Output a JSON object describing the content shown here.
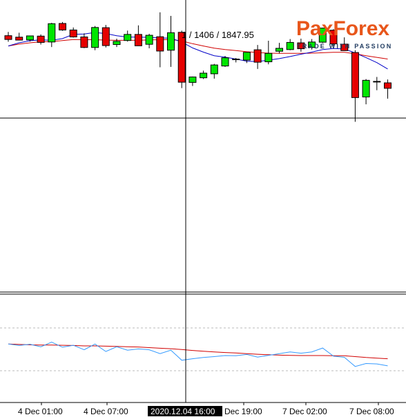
{
  "brand": {
    "name_part1": "Pa",
    "name_mark": "x",
    "name_part2": "Forex",
    "tagline": "TRADE WITH PASSION",
    "orange": "#e8561b",
    "navy": "#1f3a5f"
  },
  "crosshair_readout": "1 / 1406 / 1847.95",
  "colors": {
    "bull": "#00e600",
    "bear": "#e60000",
    "ma_fast": "#0000c8",
    "ma_slow": "#d00000",
    "osc_fast": "#3399ff",
    "osc_slow": "#d00000",
    "grid": "#bbbbbb",
    "crosshair": "#000000"
  },
  "chart_data": [
    {
      "type": "candlestick",
      "timeframe": "1 hour",
      "x_tick_labels": [
        "4 Dec 01:00",
        "4 Dec 07:00",
        "2020.12.04 16:00",
        "Dec 19:00",
        "7 Dec 02:00",
        "7 Dec 08:00"
      ],
      "highlighted_x_label": "2020.12.04 16:00",
      "candles": [
        {
          "o": 1847.4,
          "h": 1849.2,
          "l": 1844.5,
          "c": 1845.6
        },
        {
          "o": 1846.7,
          "h": 1848.8,
          "l": 1845.2,
          "c": 1845.3
        },
        {
          "o": 1845.4,
          "h": 1846.5,
          "l": 1844.6,
          "c": 1847.3
        },
        {
          "o": 1847.2,
          "h": 1848.0,
          "l": 1843.2,
          "c": 1844.2
        },
        {
          "o": 1844.4,
          "h": 1853.5,
          "l": 1842.0,
          "c": 1853.1
        },
        {
          "o": 1853.2,
          "h": 1853.9,
          "l": 1849.7,
          "c": 1850.1
        },
        {
          "o": 1850.1,
          "h": 1851.3,
          "l": 1846.5,
          "c": 1846.8
        },
        {
          "o": 1846.8,
          "h": 1848.5,
          "l": 1841.5,
          "c": 1841.8
        },
        {
          "o": 1841.8,
          "h": 1852.0,
          "l": 1840.5,
          "c": 1851.3
        },
        {
          "o": 1851.2,
          "h": 1852.5,
          "l": 1841.8,
          "c": 1842.7
        },
        {
          "o": 1843.2,
          "h": 1846.0,
          "l": 1842.0,
          "c": 1844.7
        },
        {
          "o": 1845.1,
          "h": 1849.8,
          "l": 1844.6,
          "c": 1848.0
        },
        {
          "o": 1848.0,
          "h": 1852.3,
          "l": 1843.4,
          "c": 1842.6
        },
        {
          "o": 1843.3,
          "h": 1848.3,
          "l": 1841.4,
          "c": 1847.6
        },
        {
          "o": 1846.9,
          "h": 1858.5,
          "l": 1832.4,
          "c": 1840.1
        },
        {
          "o": 1840.5,
          "h": 1856.8,
          "l": 1832.6,
          "c": 1848.8
        },
        {
          "o": 1849.0,
          "h": 1849.8,
          "l": 1822.5,
          "c": 1825.3
        },
        {
          "o": 1825.2,
          "h": 1828.0,
          "l": 1823.5,
          "c": 1827.8
        },
        {
          "o": 1827.4,
          "h": 1830.8,
          "l": 1826.8,
          "c": 1829.6
        },
        {
          "o": 1829.3,
          "h": 1834.0,
          "l": 1827.0,
          "c": 1833.5
        },
        {
          "o": 1833.0,
          "h": 1837.8,
          "l": 1832.6,
          "c": 1836.9
        },
        {
          "o": 1836.3,
          "h": 1836.8,
          "l": 1834.7,
          "c": 1836.2
        },
        {
          "o": 1835.8,
          "h": 1838.8,
          "l": 1834.4,
          "c": 1839.5
        },
        {
          "o": 1840.7,
          "h": 1843.0,
          "l": 1831.6,
          "c": 1834.8
        },
        {
          "o": 1835.0,
          "h": 1845.0,
          "l": 1833.8,
          "c": 1839.0
        },
        {
          "o": 1840.0,
          "h": 1844.0,
          "l": 1839.0,
          "c": 1841.4
        },
        {
          "o": 1840.8,
          "h": 1845.8,
          "l": 1840.5,
          "c": 1844.2
        },
        {
          "o": 1844.0,
          "h": 1846.0,
          "l": 1839.8,
          "c": 1841.2
        },
        {
          "o": 1841.8,
          "h": 1845.8,
          "l": 1840.8,
          "c": 1844.4
        },
        {
          "o": 1844.3,
          "h": 1851.2,
          "l": 1843.9,
          "c": 1851.0
        },
        {
          "o": 1850.0,
          "h": 1850.5,
          "l": 1842.5,
          "c": 1843.5
        },
        {
          "o": 1843.4,
          "h": 1846.6,
          "l": 1840.3,
          "c": 1840.3
        },
        {
          "o": 1839.4,
          "h": 1840.5,
          "l": 1806.5,
          "c": 1818.0
        },
        {
          "o": 1818.3,
          "h": 1826.8,
          "l": 1814.8,
          "c": 1826.2
        },
        {
          "o": 1825.6,
          "h": 1827.8,
          "l": 1821.5,
          "c": 1825.7
        },
        {
          "o": 1825.0,
          "h": 1826.6,
          "l": 1817.5,
          "c": 1822.4
        }
      ],
      "moving_average_fast": [
        1842.5,
        1844.0,
        1845.0,
        1845.4,
        1845.2,
        1846.0,
        1848.0,
        1848.2,
        1848.9,
        1848.4,
        1847.4,
        1846.7,
        1846.7,
        1846.6,
        1846.3,
        1846.2,
        1844.4,
        1841.6,
        1839.6,
        1837.9,
        1837.2,
        1836.3,
        1835.3,
        1835.1,
        1835.8,
        1836.5,
        1837.5,
        1838.6,
        1839.6,
        1840.8,
        1841.3,
        1841.1,
        1839.2,
        1837.0,
        1834.6,
        1831.6
      ],
      "moving_average_slow": [
        1842.5,
        1843.4,
        1844.0,
        1844.5,
        1844.6,
        1845.1,
        1845.6,
        1845.5,
        1845.5,
        1845.3,
        1845.2,
        1845.2,
        1845.2,
        1845.4,
        1845.5,
        1845.6,
        1844.9,
        1843.6,
        1842.5,
        1841.5,
        1840.8,
        1840.3,
        1839.8,
        1839.4,
        1839.1,
        1839.0,
        1839.0,
        1839.0,
        1839.1,
        1839.3,
        1839.5,
        1839.5,
        1838.8,
        1837.9,
        1837.1,
        1836.3
      ]
    },
    {
      "type": "line",
      "panel": "oscillator",
      "series": [
        {
          "values": [
            22.5,
            21.8,
            22.4,
            21.2,
            23.4,
            21.0,
            21.9,
            19.8,
            22.5,
            19.0,
            21.2,
            19.6,
            20.2,
            19.8,
            18.0,
            19.6,
            14.9,
            15.6,
            16.2,
            16.6,
            17.1,
            17.0,
            17.6,
            16.4,
            17.2,
            18.0,
            18.8,
            18.2,
            18.8,
            20.6,
            16.8,
            16.3,
            12.0,
            13.4,
            13.2,
            12.3
          ]
        },
        {
          "values": [
            22.5,
            22.3,
            22.1,
            22.0,
            22.0,
            21.9,
            21.8,
            21.6,
            21.6,
            21.5,
            21.4,
            21.2,
            21.1,
            20.8,
            20.5,
            20.3,
            19.9,
            19.5,
            19.1,
            18.8,
            18.5,
            18.3,
            18.0,
            17.7,
            17.5,
            17.3,
            17.2,
            17.1,
            17.1,
            17.1,
            17.0,
            17.0,
            16.6,
            16.2,
            15.9,
            15.6
          ]
        }
      ],
      "levels": [
        30,
        10
      ]
    }
  ]
}
